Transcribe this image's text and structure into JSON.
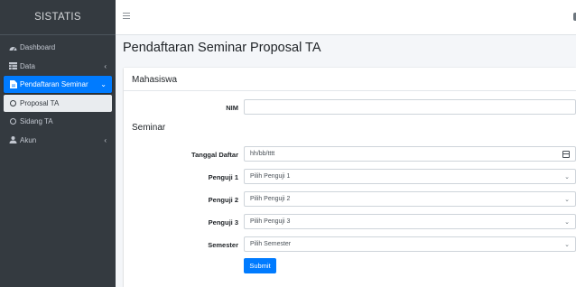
{
  "brand": "SISTATIS",
  "sidebar": {
    "items": [
      {
        "label": "Dashboard",
        "icon": "dashboard-icon"
      },
      {
        "label": "Data",
        "icon": "table-icon",
        "chevron": "‹"
      },
      {
        "label": "Pendaftaran Seminar",
        "icon": "document-icon",
        "chevron": "⌄"
      },
      {
        "label": "Proposal TA",
        "icon": "circle-icon"
      },
      {
        "label": "Sidang TA",
        "icon": "circle-icon"
      },
      {
        "label": "Akun",
        "icon": "user-icon",
        "chevron": "‹"
      }
    ]
  },
  "page": {
    "title": "Pendaftaran Seminar Proposal TA"
  },
  "form": {
    "section_mahasiswa": "Mahasiswa",
    "section_seminar": "Seminar",
    "nim_label": "NIM",
    "nim_value": "",
    "tanggal_label": "Tanggal Daftar",
    "tanggal_placeholder": "hh/bb/tttt",
    "penguji1_label": "Penguji 1",
    "penguji1_value": "Pilih Penguji 1",
    "penguji2_label": "Penguji 2",
    "penguji2_value": "Pilih Penguji 2",
    "penguji3_label": "Penguji 3",
    "penguji3_value": "Pilih Penguji 3",
    "semester_label": "Semester",
    "semester_value": "Pilih Semester",
    "submit_label": "Submit",
    "select_caret": "⌄"
  },
  "colors": {
    "sidebar_bg": "#343a40",
    "accent": "#007bff"
  }
}
